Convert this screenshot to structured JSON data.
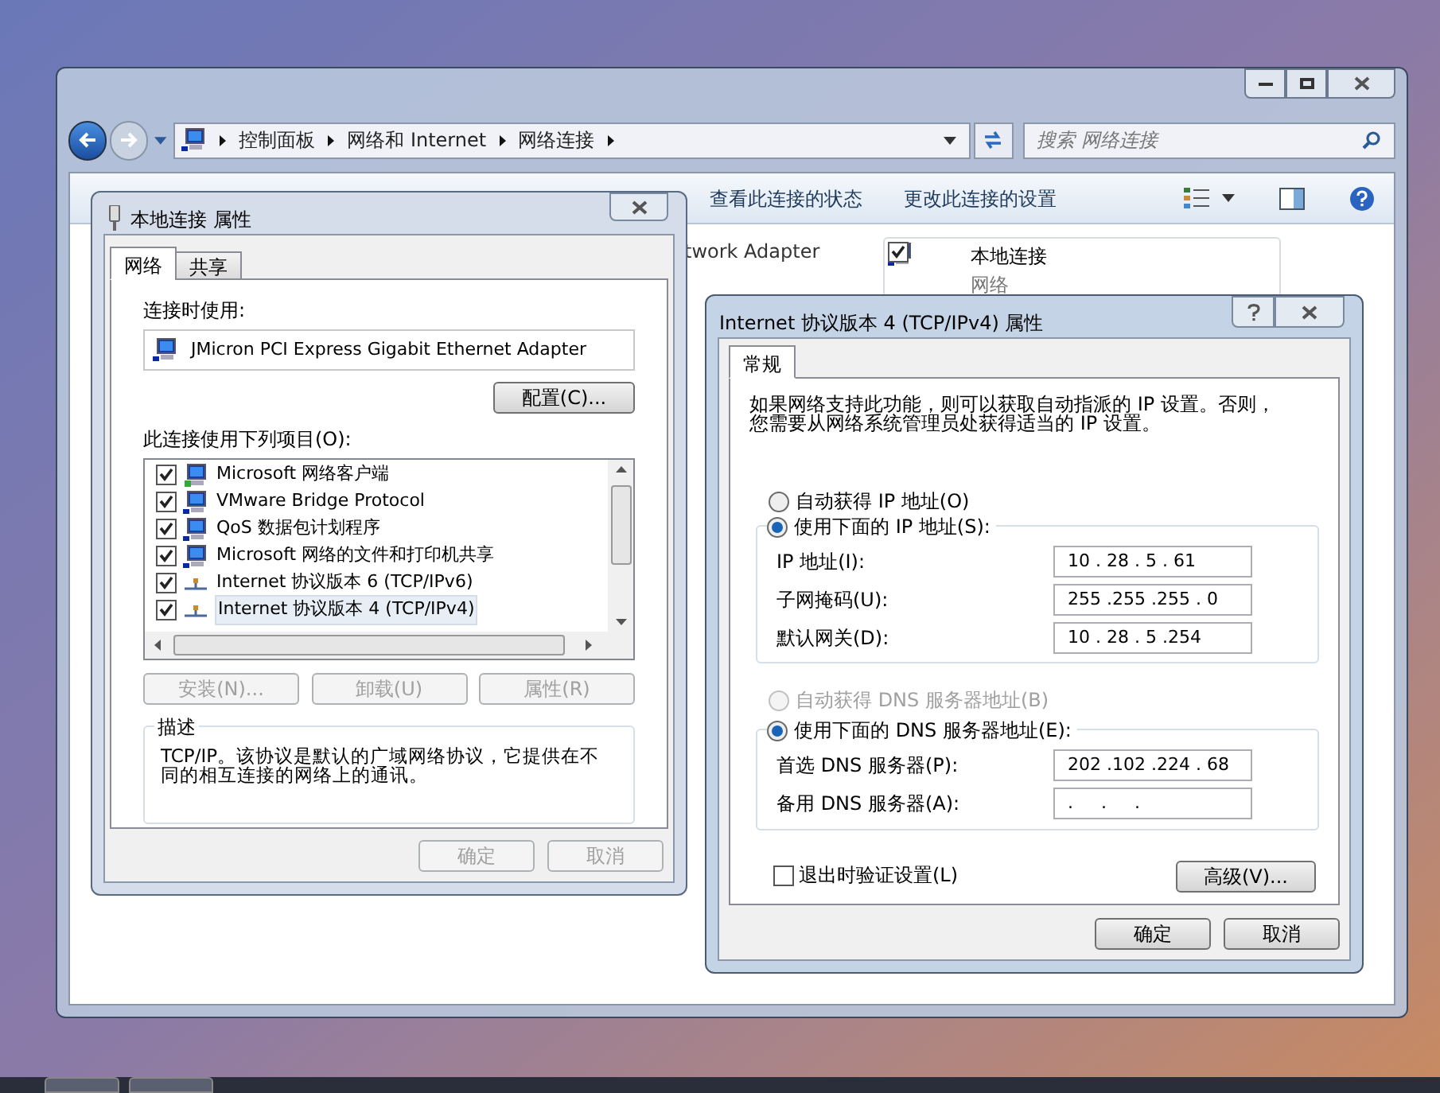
{
  "explorer": {
    "breadcrumb": [
      "控制面板",
      "网络和 Internet",
      "网络连接"
    ],
    "search": {
      "placeholder": "搜索 网络连接"
    },
    "toolbar": [
      "查看此连接的状态",
      "更改此连接的设置"
    ],
    "partial_text": "twork Adapter",
    "connection": {
      "name": "本地连接",
      "subtitle": "网络",
      "checked": true
    }
  },
  "local_dialog": {
    "title": "本地连接 属性",
    "tabs": [
      {
        "label": "网络",
        "selected": true
      },
      {
        "label": "共享",
        "selected": false
      }
    ],
    "connect_using_label": "连接时使用:",
    "adapter": "JMicron PCI Express Gigabit Ethernet Adapter",
    "configure_button": "配置(C)...",
    "items_label": "此连接使用下列项目(O):",
    "items": [
      {
        "label": "Microsoft 网络客户端",
        "checked": true,
        "selected": false,
        "kind": "client"
      },
      {
        "label": "VMware Bridge Protocol",
        "checked": true,
        "selected": false,
        "kind": "service"
      },
      {
        "label": "QoS 数据包计划程序",
        "checked": true,
        "selected": false,
        "kind": "service"
      },
      {
        "label": "Microsoft 网络的文件和打印机共享",
        "checked": true,
        "selected": false,
        "kind": "service"
      },
      {
        "label": "Internet 协议版本 6 (TCP/IPv6)",
        "checked": true,
        "selected": false,
        "kind": "protocol"
      },
      {
        "label": "Internet 协议版本 4 (TCP/IPv4)",
        "checked": true,
        "selected": true,
        "kind": "protocol"
      }
    ],
    "buttons": [
      {
        "label": "安装(N)...",
        "disabled": true
      },
      {
        "label": "卸载(U)",
        "disabled": true
      },
      {
        "label": "属性(R)",
        "disabled": true
      }
    ],
    "description": {
      "title": "描述",
      "text": "TCP/IP。该协议是默认的广域网络协议，它提供在不同的相互连接的网络上的通讯。"
    },
    "footer_buttons": [
      {
        "label": "确定",
        "disabled": true
      },
      {
        "label": "取消",
        "disabled": true
      }
    ]
  },
  "ipv4_dialog": {
    "title": "Internet 协议版本 4 (TCP/IPv4) 属性",
    "tabs": [
      {
        "label": "常规",
        "selected": true
      }
    ],
    "intro": "如果网络支持此功能，则可以获取自动指派的 IP 设置。否则，您需要从网络系统管理员处获得适当的 IP 设置。",
    "ip_radios": [
      {
        "label": "自动获得 IP 地址(O)",
        "selected": false,
        "disabled": false
      },
      {
        "label": "使用下面的 IP 地址(S):",
        "selected": true,
        "disabled": false
      }
    ],
    "ip_fields": [
      {
        "label": "IP 地址(I):",
        "value": "10 . 28 . 5 . 61"
      },
      {
        "label": "子网掩码(U):",
        "value": "255 .255 .255 . 0"
      },
      {
        "label": "默认网关(D):",
        "value": "10 . 28 . 5 .254"
      }
    ],
    "dns_radios": [
      {
        "label": "自动获得 DNS 服务器地址(B)",
        "selected": false,
        "disabled": true
      },
      {
        "label": "使用下面的 DNS 服务器地址(E):",
        "selected": true,
        "disabled": false
      }
    ],
    "dns_fields": [
      {
        "label": "首选 DNS 服务器(P):",
        "value": "202 .102 .224 . 68"
      },
      {
        "label": "备用 DNS 服务器(A):",
        "value": ".     .     ."
      }
    ],
    "validate": {
      "label": "退出时验证设置(L)",
      "checked": false
    },
    "advanced_button": "高级(V)...",
    "footer_buttons": [
      {
        "label": "确定",
        "disabled": false
      },
      {
        "label": "取消",
        "disabled": false
      }
    ]
  }
}
